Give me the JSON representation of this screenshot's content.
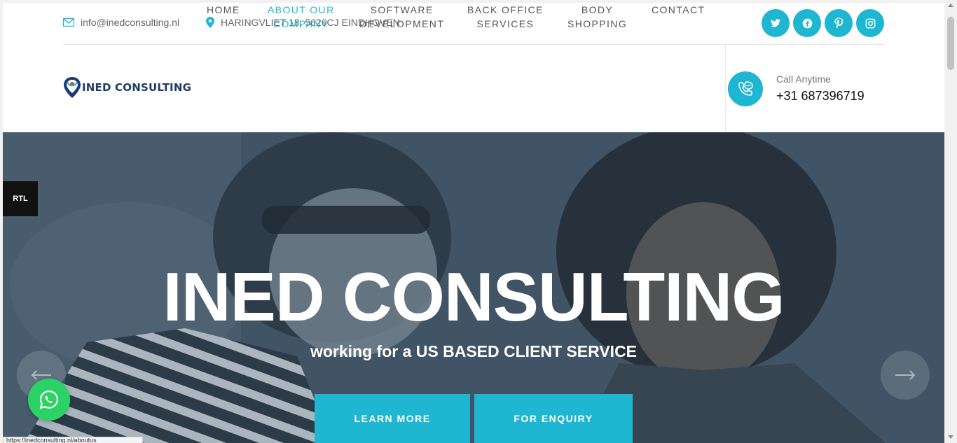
{
  "topbar": {
    "email": "info@inedconsulting.nl",
    "address": "HARINGVLIET 18, 5626CJ EINDHOVEN",
    "socials": [
      "twitter-icon",
      "facebook-icon",
      "pinterest-icon",
      "instagram-icon"
    ]
  },
  "logo": {
    "text": "INED CONSULTING"
  },
  "nav": [
    {
      "line1": "HOME",
      "line2": ""
    },
    {
      "line1": "ABOUT OUR",
      "line2": "COMPANY"
    },
    {
      "line1": "SOFTWARE",
      "line2": "DEVELOPMENT"
    },
    {
      "line1": "BACK OFFICE",
      "line2": "SERVICES"
    },
    {
      "line1": "BODY",
      "line2": "SHOPPING"
    },
    {
      "line1": "CONTACT",
      "line2": ""
    }
  ],
  "call": {
    "label": "Call Anytime",
    "number": "+31 687396719"
  },
  "hero": {
    "title": "INED CONSULTING",
    "subtitle": "working for a US BASED CLIENT SERVICE",
    "btn_learn": "LEARN MORE",
    "btn_enquiry": "FOR ENQUIRY"
  },
  "rtl_label": "RTL",
  "status_url": "https://inedconsulting.nl/aboutus",
  "colors": {
    "accent": "#1fb6d1",
    "whatsapp": "#2bd366",
    "dark": "#111111"
  }
}
